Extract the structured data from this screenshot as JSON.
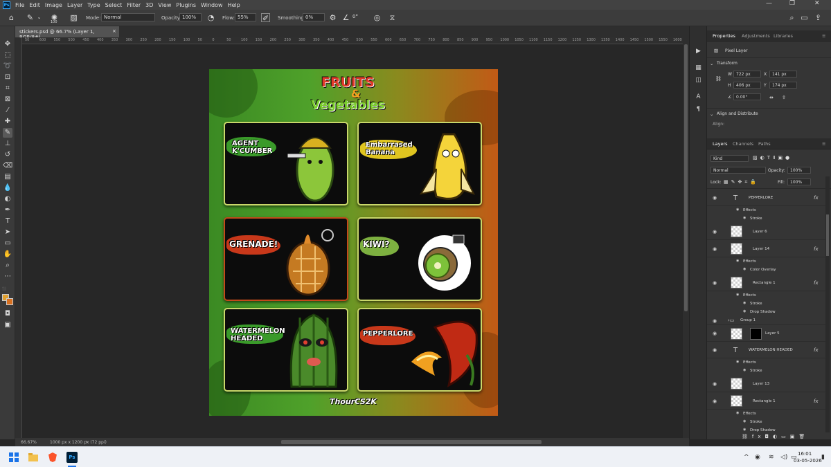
{
  "app": {
    "logo": "Ps",
    "menu": [
      "File",
      "Edit",
      "Image",
      "Layer",
      "Type",
      "Select",
      "Filter",
      "3D",
      "View",
      "Plugins",
      "Window",
      "Help"
    ]
  },
  "options": {
    "brush_size": "100",
    "mode_label": "Mode:",
    "mode_value": "Normal",
    "opacity_label": "Opacity:",
    "opacity_value": "100%",
    "flow_label": "Flow:",
    "flow_value": "55%",
    "smoothing_label": "Smoothing:",
    "smoothing_value": "0%",
    "angle_value": "0°"
  },
  "document": {
    "tab_title": "stickers.psd @ 66.7% (Layer 1, RGB/8#)",
    "close": "×"
  },
  "ruler": {
    "ticks": [
      "50",
      "600",
      "550",
      "500",
      "450",
      "400",
      "350",
      "300",
      "250",
      "200",
      "150",
      "100",
      "50",
      "0",
      "50",
      "100",
      "150",
      "200",
      "250",
      "300",
      "350",
      "400",
      "450",
      "500",
      "550",
      "600",
      "650",
      "700",
      "750",
      "800",
      "850",
      "900",
      "950",
      "1000",
      "1050",
      "1100",
      "1150",
      "1200",
      "1250",
      "1300",
      "1350",
      "1400",
      "1450",
      "1500",
      "1550",
      "1600",
      "1650"
    ]
  },
  "artwork": {
    "title_line1": "FRUITS",
    "title_amp": "&",
    "title_line2": "Vegetables",
    "footer": "ThourCS2K",
    "cards": [
      {
        "label": "AGENT\nK'CUMBER",
        "brush": "#3a9a2a"
      },
      {
        "label": "Embarrased\nBanana",
        "brush": "#e0c520"
      },
      {
        "label": "GRENADE!",
        "brush": "#c8381a"
      },
      {
        "label": "KIWI?",
        "brush": "#7db040"
      },
      {
        "label": "WATERMELON\nHEADED",
        "brush": "#3a9a2a"
      },
      {
        "label": "PEPPERLORE",
        "brush": "#c8381a"
      }
    ]
  },
  "status": {
    "zoom": "66.67%",
    "doc_info": "1000 px x 1200 px (72 ppi)"
  },
  "properties": {
    "tabs": [
      "Properties",
      "Adjustments",
      "Libraries"
    ],
    "kind": "Pixel Layer",
    "transform_title": "Transform",
    "w_label": "W",
    "w_value": "722 px",
    "h_label": "H",
    "h_value": "406 px",
    "x_label": "X",
    "x_value": "141 px",
    "y_label": "Y",
    "y_value": "174 px",
    "angle_value": "0.00°",
    "align_title": "Align and Distribute",
    "align_label": "Align:"
  },
  "layers_panel": {
    "tabs": [
      "Layers",
      "Channels",
      "Paths"
    ],
    "filter_value": "Kind",
    "blend_value": "Normal",
    "opacity_label": "Opacity:",
    "opacity_value": "100%",
    "lock_label": "Lock:",
    "fill_label": "Fill:",
    "fill_value": "100%",
    "rows": [
      {
        "name": "PEPPERLORE",
        "kind": "text",
        "fx": true
      },
      {
        "name": "Effects",
        "kind": "sub1"
      },
      {
        "name": "Stroke",
        "kind": "sub2"
      },
      {
        "name": "Layer 6",
        "kind": "pixel"
      },
      {
        "name": "Layer 14",
        "kind": "pixel",
        "fx": true
      },
      {
        "name": "Effects",
        "kind": "sub1"
      },
      {
        "name": "Color Overlay",
        "kind": "sub2"
      },
      {
        "name": "Rectangle 1",
        "kind": "shape",
        "fx": true
      },
      {
        "name": "Effects",
        "kind": "sub1"
      },
      {
        "name": "Stroke",
        "kind": "sub2"
      },
      {
        "name": "Drop Shadow",
        "kind": "sub2"
      },
      {
        "name": "Group 1",
        "kind": "group"
      },
      {
        "name": "Layer 5",
        "kind": "masked"
      },
      {
        "name": "WATERMELON HEADED",
        "kind": "text",
        "fx": true
      },
      {
        "name": "Effects",
        "kind": "sub1"
      },
      {
        "name": "Stroke",
        "kind": "sub2"
      },
      {
        "name": "Layer 13",
        "kind": "pixel"
      },
      {
        "name": "Rectangle 1",
        "kind": "shape",
        "fx": true
      },
      {
        "name": "Effects",
        "kind": "sub1"
      },
      {
        "name": "Stroke",
        "kind": "sub2"
      },
      {
        "name": "Drop Shadow",
        "kind": "sub2"
      }
    ]
  },
  "taskbar": {
    "time": "16:01",
    "date": "03-05-2026",
    "ps_label": "Ps"
  }
}
